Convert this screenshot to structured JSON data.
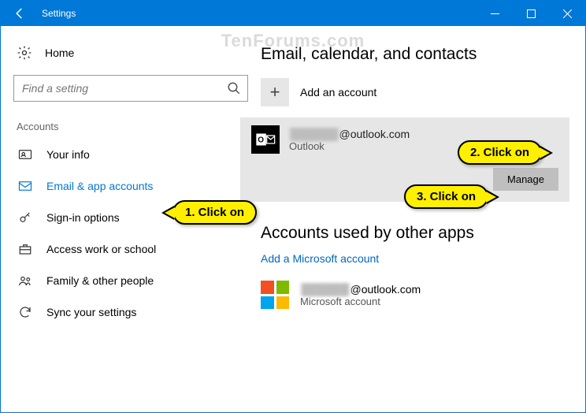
{
  "titlebar": {
    "title": "Settings"
  },
  "sidebar": {
    "home": "Home",
    "search_placeholder": "Find a setting",
    "category": "Accounts",
    "items": [
      {
        "label": "Your info"
      },
      {
        "label": "Email & app accounts"
      },
      {
        "label": "Sign-in options"
      },
      {
        "label": "Access work or school"
      },
      {
        "label": "Family & other people"
      },
      {
        "label": "Sync your settings"
      }
    ]
  },
  "main": {
    "section1_title": "Email, calendar, and contacts",
    "add_account": "Add an account",
    "account": {
      "email_hidden": "██████",
      "email_domain": "@outlook.com",
      "provider": "Outlook",
      "manage": "Manage"
    },
    "section2_title": "Accounts used by other apps",
    "add_ms_link": "Add a Microsoft account",
    "ms_account": {
      "email_hidden": "██████",
      "email_domain": "@outlook.com",
      "type": "Microsoft account"
    }
  },
  "callouts": {
    "c1": "1. Click on",
    "c2": "2. Click on",
    "c3": "3. Click on"
  },
  "watermark": "TenForums.com"
}
